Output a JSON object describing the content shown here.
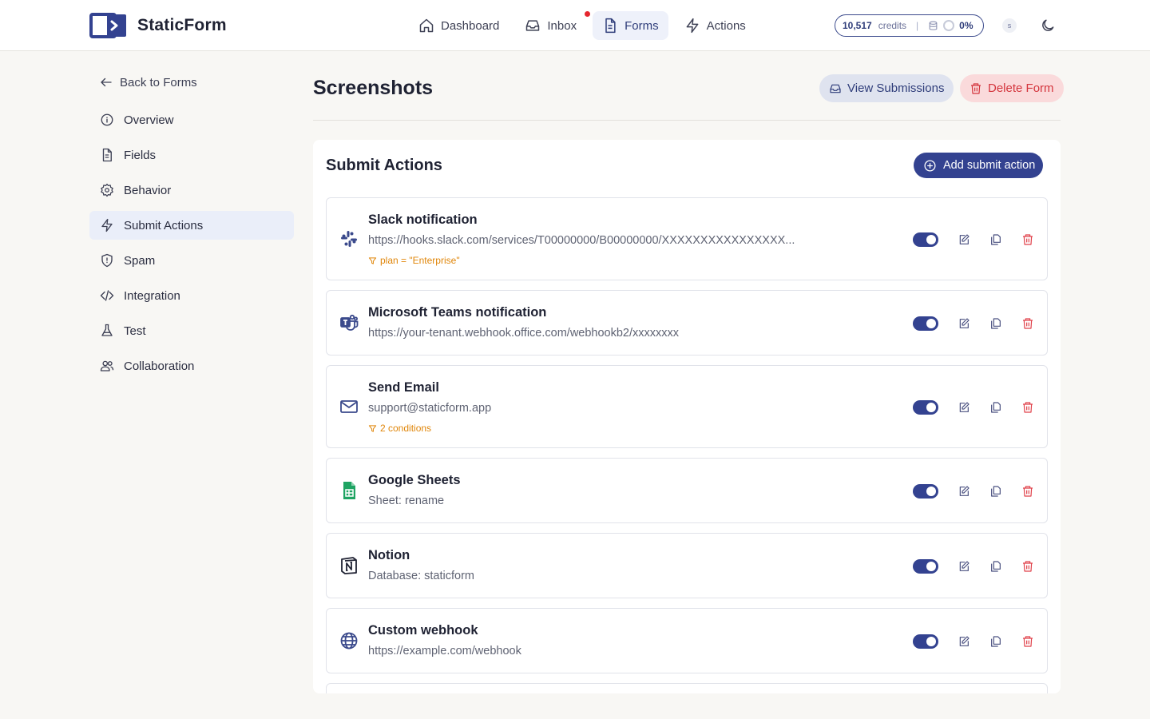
{
  "app": {
    "name": "StaticForm",
    "nav": [
      {
        "label": "Dashboard",
        "icon": "home-icon"
      },
      {
        "label": "Inbox",
        "icon": "inbox-icon",
        "has_notification": true
      },
      {
        "label": "Forms",
        "icon": "document-icon",
        "active": true
      },
      {
        "label": "Actions",
        "icon": "lightning-icon"
      }
    ],
    "credits": {
      "count": "10,517",
      "label": "credits",
      "usage": "0%"
    },
    "avatar_initial": "s"
  },
  "sidebar": {
    "back_label": "Back to Forms",
    "items": [
      {
        "label": "Overview",
        "icon": "info-icon"
      },
      {
        "label": "Fields",
        "icon": "file-icon"
      },
      {
        "label": "Behavior",
        "icon": "gear-icon"
      },
      {
        "label": "Submit Actions",
        "icon": "lightning-icon",
        "active": true
      },
      {
        "label": "Spam",
        "icon": "shield-icon"
      },
      {
        "label": "Integration",
        "icon": "code-icon"
      },
      {
        "label": "Test",
        "icon": "flask-icon"
      },
      {
        "label": "Collaboration",
        "icon": "users-icon"
      }
    ]
  },
  "page": {
    "title": "Screenshots",
    "view_submissions_label": "View Submissions",
    "delete_form_label": "Delete Form"
  },
  "submit_actions": {
    "title": "Submit Actions",
    "add_label": "Add submit action",
    "items": [
      {
        "name": "Slack notification",
        "detail": "https://hooks.slack.com/services/T00000000/B00000000/XXXXXXXXXXXXXXXX...",
        "condition": "plan = \"Enterprise\"",
        "icon": "slack-icon",
        "enabled": true
      },
      {
        "name": "Microsoft Teams notification",
        "detail": "https://your-tenant.webhook.office.com/webhookb2/xxxxxxxx",
        "condition": "",
        "icon": "teams-icon",
        "enabled": true
      },
      {
        "name": "Send Email",
        "detail": "support@staticform.app",
        "condition": "2 conditions",
        "icon": "mail-icon",
        "enabled": true
      },
      {
        "name": "Google Sheets",
        "detail": "Sheet: rename",
        "condition": "",
        "icon": "google-sheets-icon",
        "enabled": true
      },
      {
        "name": "Notion",
        "detail": "Database: staticform",
        "condition": "",
        "icon": "notion-icon",
        "enabled": true
      },
      {
        "name": "Custom webhook",
        "detail": "https://example.com/webhook",
        "condition": "",
        "icon": "globe-icon",
        "enabled": true
      }
    ]
  },
  "colors": {
    "accent": "#334290",
    "danger": "#e0414a",
    "condition": "#e0860a",
    "background": "#f8f7f4"
  }
}
